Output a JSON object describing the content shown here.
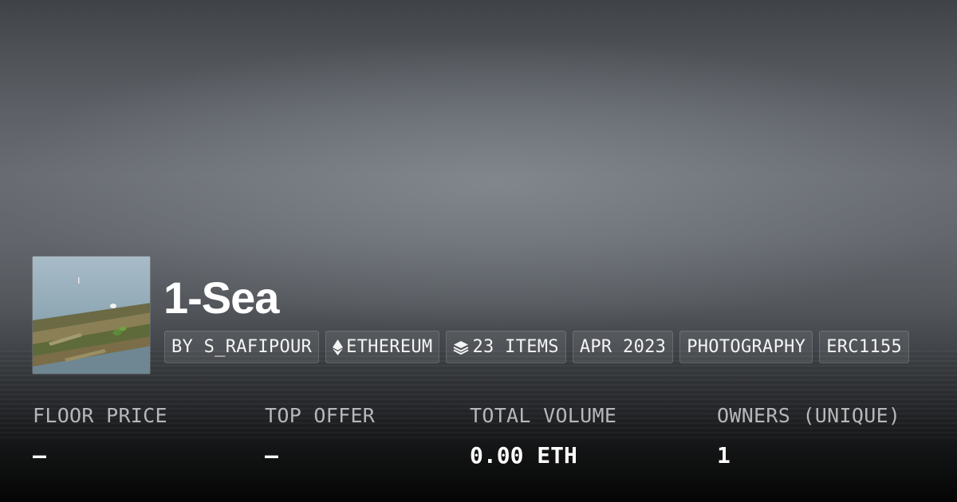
{
  "collection": {
    "title": "1-Sea"
  },
  "tags": [
    {
      "label": "BY S_RAFIPOUR",
      "icon": ""
    },
    {
      "label": "ETHEREUM",
      "icon": "ethereum-icon"
    },
    {
      "label": "23 ITEMS",
      "icon": "layers-icon"
    },
    {
      "label": "APR 2023",
      "icon": ""
    },
    {
      "label": "PHOTOGRAPHY",
      "icon": ""
    },
    {
      "label": "ERC1155",
      "icon": ""
    }
  ],
  "stats": [
    {
      "label": "FLOOR PRICE",
      "value": "–"
    },
    {
      "label": "TOP OFFER",
      "value": "–"
    },
    {
      "label": "TOTAL VOLUME",
      "value": "0.00 ETH"
    },
    {
      "label": "OWNERS (UNIQUE)",
      "value": "1"
    }
  ],
  "colors": {
    "text": "#ffffff",
    "label": "#b5b7ba",
    "tag_bg": "rgba(255,255,255,0.08)"
  }
}
